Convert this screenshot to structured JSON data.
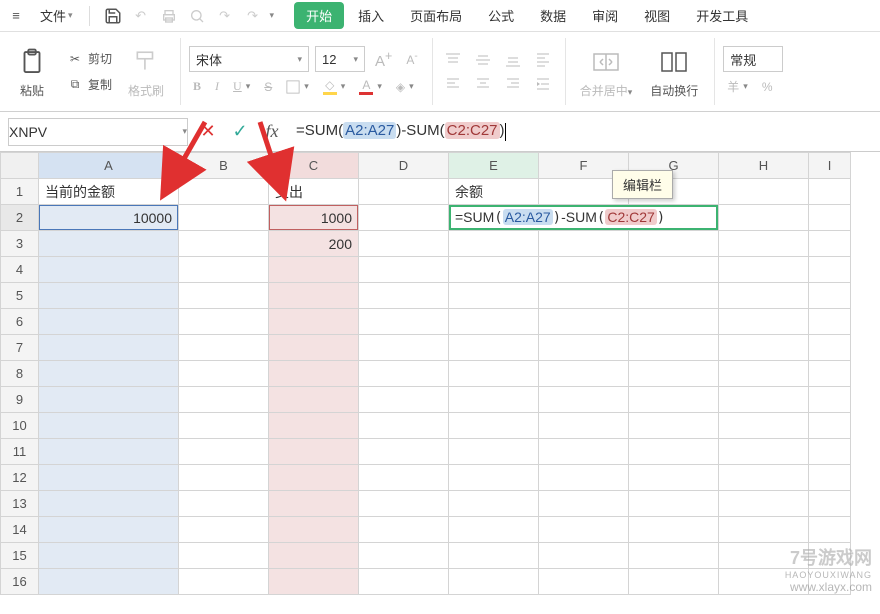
{
  "topbar": {
    "file_label": "文件",
    "tabs": [
      "开始",
      "插入",
      "页面布局",
      "公式",
      "数据",
      "审阅",
      "视图",
      "开发工具"
    ]
  },
  "ribbon": {
    "paste_label": "粘贴",
    "cut_label": "剪切",
    "copy_label": "复制",
    "format_painter": "格式刷",
    "font_name": "宋体",
    "font_size": "12",
    "merge_label": "合并居中",
    "wrap_label": "自动换行",
    "number_format": "常规",
    "currency_icon": "羊"
  },
  "formula_bar": {
    "name_box": "XNPV",
    "formula_prefix": "=SUM",
    "ref1": "A2:A27",
    "mid": "-SUM",
    "ref2": "C2:C27",
    "tooltip": "编辑栏"
  },
  "grid": {
    "col_headers": [
      "A",
      "B",
      "C",
      "D",
      "E",
      "F",
      "G",
      "H",
      "I"
    ],
    "row_count": 16,
    "cells": {
      "A1": "当前的金额",
      "C1": "支出",
      "E1": "余额",
      "A2": "10000",
      "C2": "1000",
      "C3": "200",
      "E2_display_prefix": "=SUM",
      "E2_ref1": "A2:A27",
      "E2_mid": "-SUM",
      "E2_ref2": "C2:C27"
    }
  },
  "watermark": {
    "site": "7号游戏网",
    "pinyin": "HAOYOUXIWANG",
    "url": "www.xlayx.com"
  },
  "icons": {
    "hamburger": "≡",
    "save": "💾",
    "undo": "↶",
    "redo": "↷",
    "print": "🖨",
    "scissors": "✂",
    "copy": "⧉",
    "brush": "🖌",
    "down": "▾"
  }
}
